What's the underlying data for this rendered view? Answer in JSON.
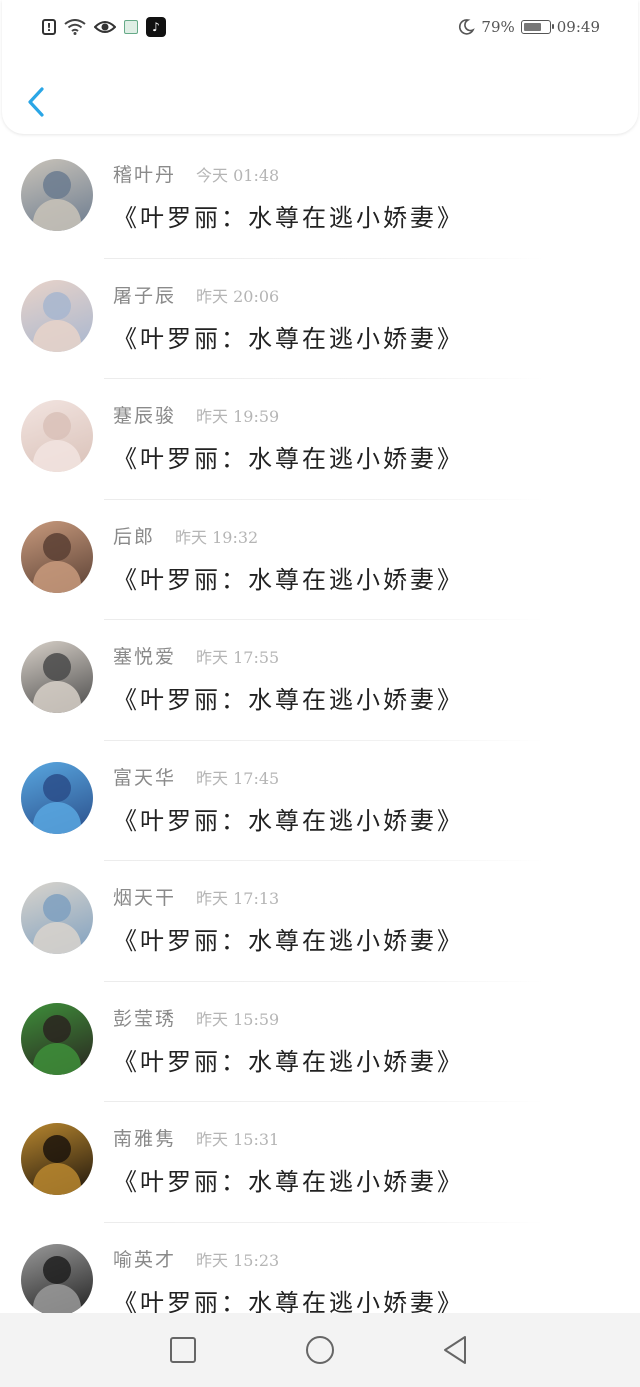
{
  "status_bar": {
    "left_icons": [
      "alert-icon",
      "wifi-icon",
      "eye-icon",
      "app-icon",
      "tiktok-icon"
    ],
    "right_icons": [
      "moon-icon",
      "battery-icon"
    ],
    "battery": "79%",
    "battery_level": 0.79,
    "time": "09:49"
  },
  "header": {
    "back_icon": "chevron-left-icon",
    "accent_color": "#2aa6e6"
  },
  "messages": [
    {
      "name": "稽叶丹",
      "time": "今天 01:48",
      "text": "《叶罗丽：水尊在逃小娇妻》",
      "avatar_colors": [
        "#c9c3b9",
        "#6b7b8f"
      ]
    },
    {
      "name": "屠子辰",
      "time": "昨天 20:06",
      "text": "《叶罗丽：水尊在逃小娇妻》",
      "avatar_colors": [
        "#e8d3c9",
        "#a7b6cf"
      ]
    },
    {
      "name": "蹇辰骏",
      "time": "昨天 19:59",
      "text": "《叶罗丽：水尊在逃小娇妻》",
      "avatar_colors": [
        "#f2e4e0",
        "#d9c1b8"
      ]
    },
    {
      "name": "后郎",
      "time": "昨天 19:32",
      "text": "《叶罗丽：水尊在逃小娇妻》",
      "avatar_colors": [
        "#c89a7d",
        "#5a4034"
      ]
    },
    {
      "name": "塞悦爱",
      "time": "昨天 17:55",
      "text": "《叶罗丽：水尊在逃小娇妻》",
      "avatar_colors": [
        "#d7d0c8",
        "#4a4a4a"
      ]
    },
    {
      "name": "富天华",
      "time": "昨天 17:45",
      "text": "《叶罗丽：水尊在逃小娇妻》",
      "avatar_colors": [
        "#59a7e0",
        "#2a4e8a"
      ]
    },
    {
      "name": "烟天干",
      "time": "昨天 17:13",
      "text": "《叶罗丽：水尊在逃小娇妻》",
      "avatar_colors": [
        "#d9d4cc",
        "#7fa0c0"
      ]
    },
    {
      "name": "彭莹琇",
      "time": "昨天 15:59",
      "text": "《叶罗丽：水尊在逃小娇妻》",
      "avatar_colors": [
        "#3e8f3a",
        "#2a2420"
      ]
    },
    {
      "name": "南雅隽",
      "time": "昨天 15:31",
      "text": "《叶罗丽：水尊在逃小娇妻》",
      "avatar_colors": [
        "#b8872f",
        "#1c140c"
      ]
    },
    {
      "name": "喻英才",
      "time": "昨天 15:23",
      "text": "《叶罗丽：水尊在逃小娇妻》",
      "avatar_colors": [
        "#9a9a9a",
        "#1f1f1f"
      ]
    }
  ],
  "nav_bar": {
    "buttons": [
      "recent-apps-icon",
      "home-icon",
      "back-triangle-icon"
    ]
  }
}
